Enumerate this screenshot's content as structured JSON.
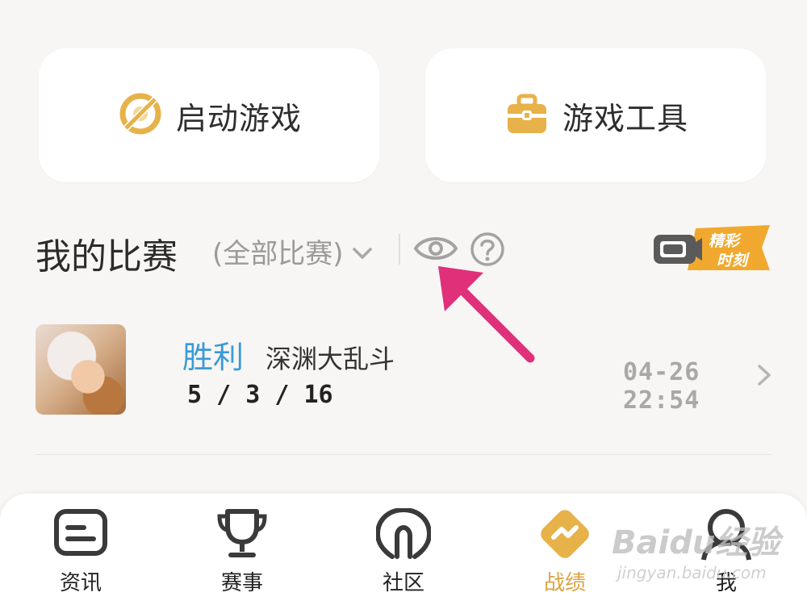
{
  "cards": {
    "launch_label": "启动游戏",
    "tools_label": "游戏工具"
  },
  "section": {
    "title": "我的比赛",
    "filter_label": "(全部比赛)",
    "highlight_badge_line1": "精彩",
    "highlight_badge_line2": "时刻"
  },
  "match": {
    "result": "胜利",
    "mode": "深渊大乱斗",
    "kda": "5 / 3 / 16",
    "time": "04-26 22:54"
  },
  "tabs": [
    {
      "label": "资讯"
    },
    {
      "label": "赛事"
    },
    {
      "label": "社区"
    },
    {
      "label": "战绩"
    },
    {
      "label": "我"
    }
  ],
  "watermark": {
    "brand": "Baidu经验",
    "url": "jingyan.baidu.com"
  },
  "colors": {
    "accent_gold": "#e7b24a",
    "win_blue": "#3a9ad8",
    "arrow_pink": "#e0307a"
  }
}
